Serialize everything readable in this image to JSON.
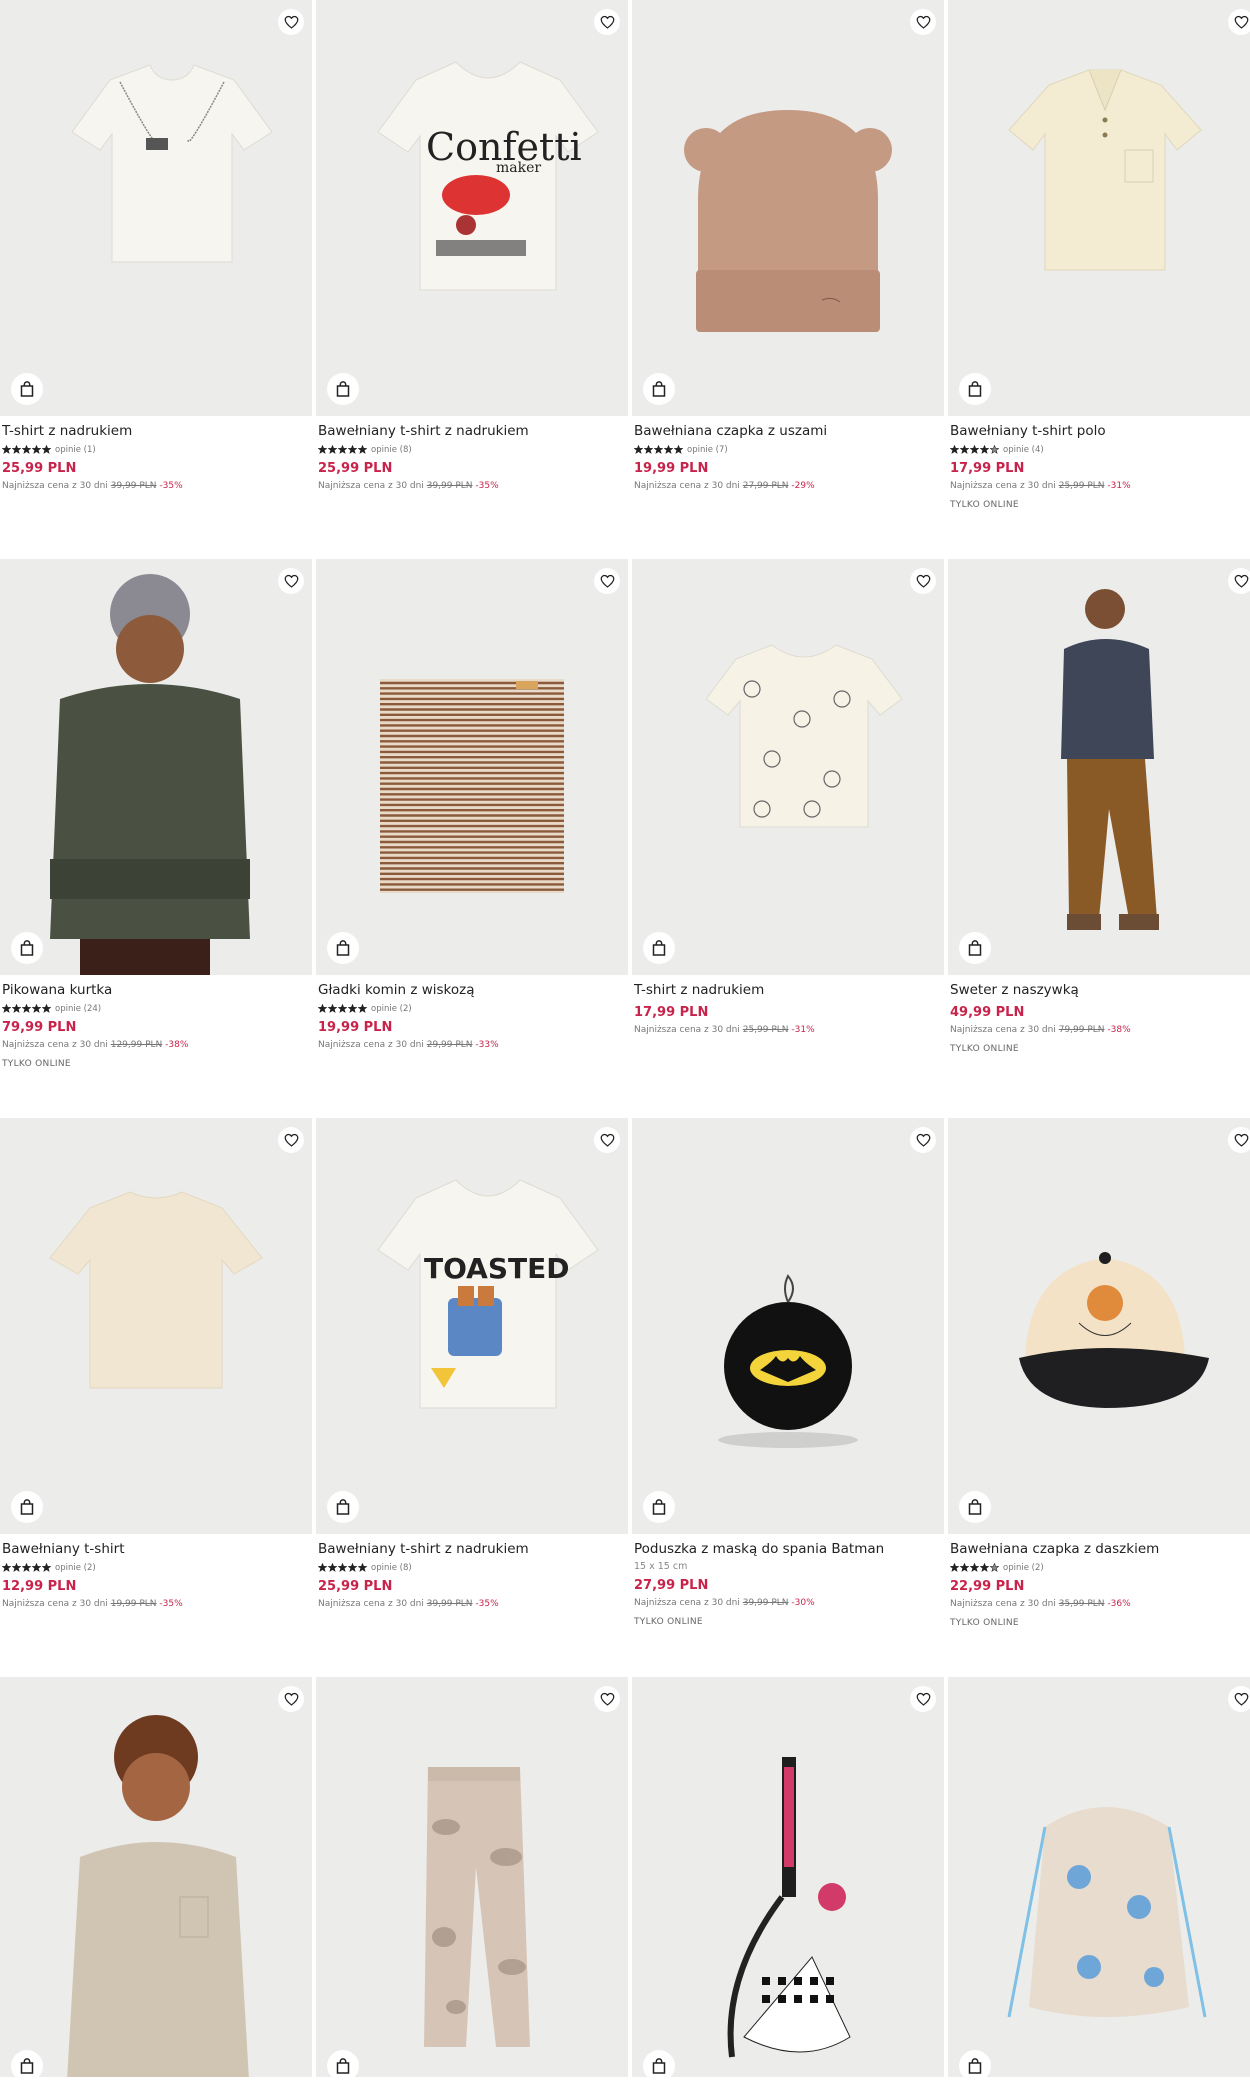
{
  "colors": {
    "price": "#c8234a",
    "image_bg": "#ececeb"
  },
  "icons": {
    "favorite": "heart-icon",
    "add_to_cart": "shopping-bag-icon",
    "star": "star-icon"
  },
  "products": [
    {
      "name": "T-shirt z nadrukiem",
      "rating": 5,
      "reviews": "opinie (1)",
      "price": "25,99 PLN",
      "lowest_label": "Najniższa cena z 30 dni",
      "old_price": "39,99 PLN",
      "discount": "-35%",
      "badge": "",
      "dims": "",
      "art": "tshirt-chain"
    },
    {
      "name": "Bawełniany t-shirt z nadrukiem",
      "rating": 5,
      "reviews": "opinie (8)",
      "price": "25,99 PLN",
      "lowest_label": "Najniższa cena z 30 dni",
      "old_price": "39,99 PLN",
      "discount": "-35%",
      "badge": "",
      "dims": "",
      "art": "tshirt-confetti"
    },
    {
      "name": "Bawełniana czapka z uszami",
      "rating": 5,
      "reviews": "opinie (7)",
      "price": "19,99 PLN",
      "lowest_label": "Najniższa cena z 30 dni",
      "old_price": "27,99 PLN",
      "discount": "-29%",
      "badge": "",
      "dims": "",
      "art": "beanie-ears"
    },
    {
      "name": "Bawełniany t-shirt polo",
      "rating": 4.5,
      "reviews": "opinie (4)",
      "price": "17,99 PLN",
      "lowest_label": "Najniższa cena z 30 dni",
      "old_price": "25,99 PLN",
      "discount": "-31%",
      "badge": "TYLKO ONLINE",
      "dims": "",
      "art": "polo"
    },
    {
      "name": "Pikowana kurtka",
      "rating": 5,
      "reviews": "opinie (24)",
      "price": "79,99 PLN",
      "lowest_label": "Najniższa cena z 30 dni",
      "old_price": "129,99 PLN",
      "discount": "-38%",
      "badge": "TYLKO ONLINE",
      "dims": "",
      "art": "boy-jacket"
    },
    {
      "name": "Gładki komin z wiskozą",
      "rating": 5,
      "reviews": "opinie (2)",
      "price": "19,99 PLN",
      "lowest_label": "Najniższa cena z 30 dni",
      "old_price": "29,99 PLN",
      "discount": "-33%",
      "badge": "",
      "dims": "",
      "art": "snood"
    },
    {
      "name": "T-shirt z nadrukiem",
      "rating": 0,
      "reviews": "",
      "price": "17,99 PLN",
      "lowest_label": "Najniższa cena z 30 dni",
      "old_price": "25,99 PLN",
      "discount": "-31%",
      "badge": "",
      "dims": "",
      "art": "tshirt-pattern"
    },
    {
      "name": "Sweter z naszywką",
      "rating": 0,
      "reviews": "",
      "price": "49,99 PLN",
      "lowest_label": "Najniższa cena z 30 dni",
      "old_price": "79,99 PLN",
      "discount": "-38%",
      "badge": "TYLKO ONLINE",
      "dims": "",
      "art": "boy-sweater"
    },
    {
      "name": "Bawełniany t-shirt",
      "rating": 5,
      "reviews": "opinie (2)",
      "price": "12,99 PLN",
      "lowest_label": "Najniższa cena z 30 dni",
      "old_price": "19,99 PLN",
      "discount": "-35%",
      "badge": "",
      "dims": "",
      "art": "tshirt-beige"
    },
    {
      "name": "Bawełniany t-shirt z nadrukiem",
      "rating": 5,
      "reviews": "opinie (8)",
      "price": "25,99 PLN",
      "lowest_label": "Najniższa cena z 30 dni",
      "old_price": "39,99 PLN",
      "discount": "-35%",
      "badge": "",
      "dims": "",
      "art": "tshirt-toasted"
    },
    {
      "name": "Poduszka z maską do spania Batman",
      "rating": 0,
      "reviews": "",
      "price": "27,99 PLN",
      "lowest_label": "Najniższa cena z 30 dni",
      "old_price": "39,99 PLN",
      "discount": "-30%",
      "badge": "TYLKO ONLINE",
      "dims": "15 x 15 cm",
      "art": "batman-pillow"
    },
    {
      "name": "Bawełniana czapka z daszkiem",
      "rating": 4.5,
      "reviews": "opinie (2)",
      "price": "22,99 PLN",
      "lowest_label": "Najniższa cena z 30 dni",
      "old_price": "35,99 PLN",
      "discount": "-36%",
      "badge": "TYLKO ONLINE",
      "dims": "",
      "art": "cap"
    },
    {
      "name": "",
      "rating": 0,
      "reviews": "",
      "price": "",
      "lowest_label": "",
      "old_price": "",
      "discount": "",
      "badge": "",
      "dims": "",
      "art": "boy-tshirt"
    },
    {
      "name": "",
      "rating": 0,
      "reviews": "",
      "price": "",
      "lowest_label": "",
      "old_price": "",
      "discount": "",
      "badge": "",
      "dims": "",
      "art": "camo-pants"
    },
    {
      "name": "",
      "rating": 0,
      "reviews": "",
      "price": "",
      "lowest_label": "",
      "old_price": "",
      "discount": "",
      "badge": "",
      "dims": "",
      "art": "keychain"
    },
    {
      "name": "",
      "rating": 0,
      "reviews": "",
      "price": "",
      "lowest_label": "",
      "old_price": "",
      "discount": "",
      "badge": "",
      "dims": "",
      "art": "drawstring-bag"
    }
  ]
}
